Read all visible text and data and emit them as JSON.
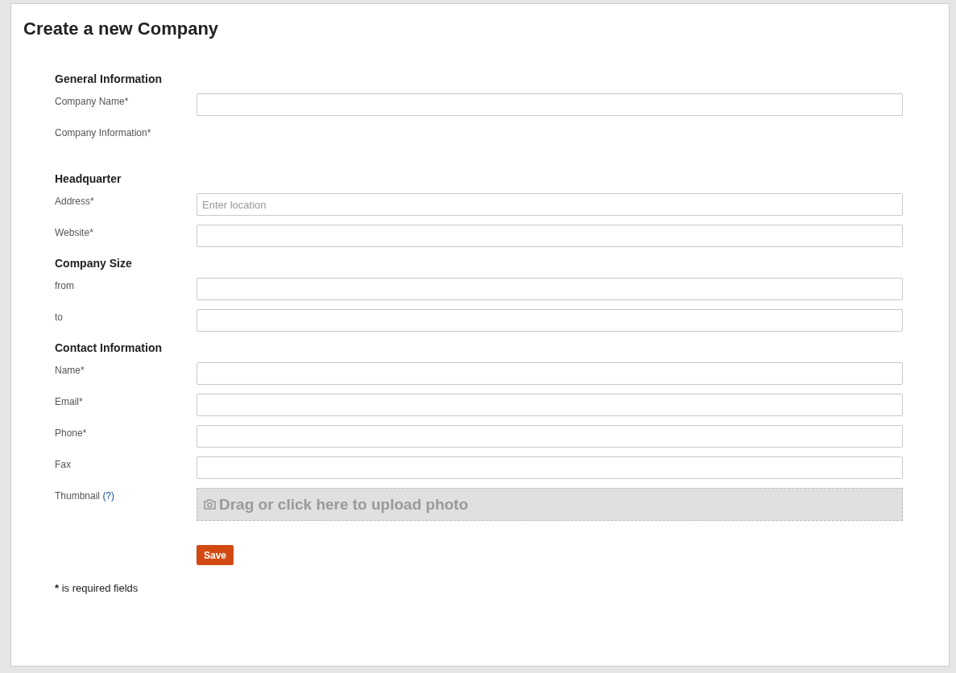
{
  "title": "Create a new Company",
  "sections": [
    {
      "heading": "General Information",
      "rows": [
        {
          "kind": "input",
          "label": "Company Name*"
        },
        {
          "kind": "label_only",
          "label": "Company Information*"
        }
      ]
    },
    {
      "heading": "Headquarter",
      "rows": [
        {
          "kind": "input",
          "label": "Address*",
          "placeholder": "Enter location"
        },
        {
          "kind": "input",
          "label": "Website*"
        }
      ]
    },
    {
      "heading": "Company Size",
      "rows": [
        {
          "kind": "input",
          "label": "from"
        },
        {
          "kind": "input",
          "label": "to"
        }
      ]
    },
    {
      "heading": "Contact Information",
      "rows": [
        {
          "kind": "input",
          "label": "Name*"
        },
        {
          "kind": "input",
          "label": "Email*"
        },
        {
          "kind": "input",
          "label": "Phone*"
        },
        {
          "kind": "input",
          "label": "Fax"
        },
        {
          "kind": "upload",
          "label": "Thumbnail",
          "help": "(?)",
          "upload_text": "Drag or click here to upload photo"
        }
      ]
    }
  ],
  "save_button": "Save",
  "note": {
    "mark": "*",
    "text": "is required fields"
  }
}
